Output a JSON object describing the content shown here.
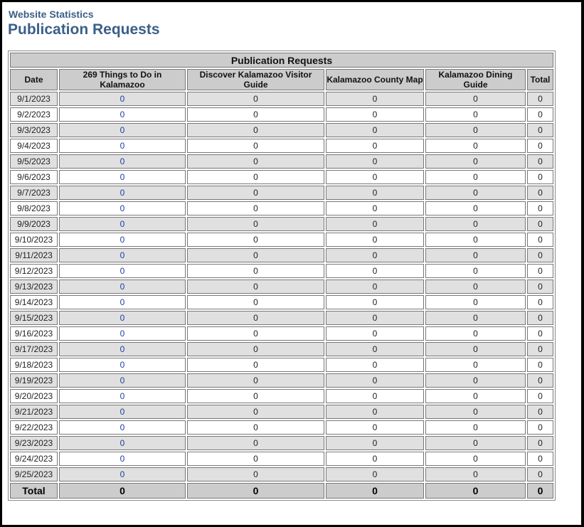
{
  "header": {
    "subtitle": "Website Statistics",
    "title": "Publication Requests"
  },
  "table": {
    "caption": "Publication Requests",
    "columns": [
      "Date",
      "269 Things to Do in Kalamazoo",
      "Discover Kalamazoo Visitor Guide",
      "Kalamazoo County Map",
      "Kalamazoo Dining Guide",
      "Total"
    ],
    "rows": [
      [
        "9/1/2023",
        "0",
        "0",
        "0",
        "0",
        "0"
      ],
      [
        "9/2/2023",
        "0",
        "0",
        "0",
        "0",
        "0"
      ],
      [
        "9/3/2023",
        "0",
        "0",
        "0",
        "0",
        "0"
      ],
      [
        "9/4/2023",
        "0",
        "0",
        "0",
        "0",
        "0"
      ],
      [
        "9/5/2023",
        "0",
        "0",
        "0",
        "0",
        "0"
      ],
      [
        "9/6/2023",
        "0",
        "0",
        "0",
        "0",
        "0"
      ],
      [
        "9/7/2023",
        "0",
        "0",
        "0",
        "0",
        "0"
      ],
      [
        "9/8/2023",
        "0",
        "0",
        "0",
        "0",
        "0"
      ],
      [
        "9/9/2023",
        "0",
        "0",
        "0",
        "0",
        "0"
      ],
      [
        "9/10/2023",
        "0",
        "0",
        "0",
        "0",
        "0"
      ],
      [
        "9/11/2023",
        "0",
        "0",
        "0",
        "0",
        "0"
      ],
      [
        "9/12/2023",
        "0",
        "0",
        "0",
        "0",
        "0"
      ],
      [
        "9/13/2023",
        "0",
        "0",
        "0",
        "0",
        "0"
      ],
      [
        "9/14/2023",
        "0",
        "0",
        "0",
        "0",
        "0"
      ],
      [
        "9/15/2023",
        "0",
        "0",
        "0",
        "0",
        "0"
      ],
      [
        "9/16/2023",
        "0",
        "0",
        "0",
        "0",
        "0"
      ],
      [
        "9/17/2023",
        "0",
        "0",
        "0",
        "0",
        "0"
      ],
      [
        "9/18/2023",
        "0",
        "0",
        "0",
        "0",
        "0"
      ],
      [
        "9/19/2023",
        "0",
        "0",
        "0",
        "0",
        "0"
      ],
      [
        "9/20/2023",
        "0",
        "0",
        "0",
        "0",
        "0"
      ],
      [
        "9/21/2023",
        "0",
        "0",
        "0",
        "0",
        "0"
      ],
      [
        "9/22/2023",
        "0",
        "0",
        "0",
        "0",
        "0"
      ],
      [
        "9/23/2023",
        "0",
        "0",
        "0",
        "0",
        "0"
      ],
      [
        "9/24/2023",
        "0",
        "0",
        "0",
        "0",
        "0"
      ],
      [
        "9/25/2023",
        "0",
        "0",
        "0",
        "0",
        "0"
      ]
    ],
    "totals": [
      "Total",
      "0",
      "0",
      "0",
      "0",
      "0"
    ]
  }
}
